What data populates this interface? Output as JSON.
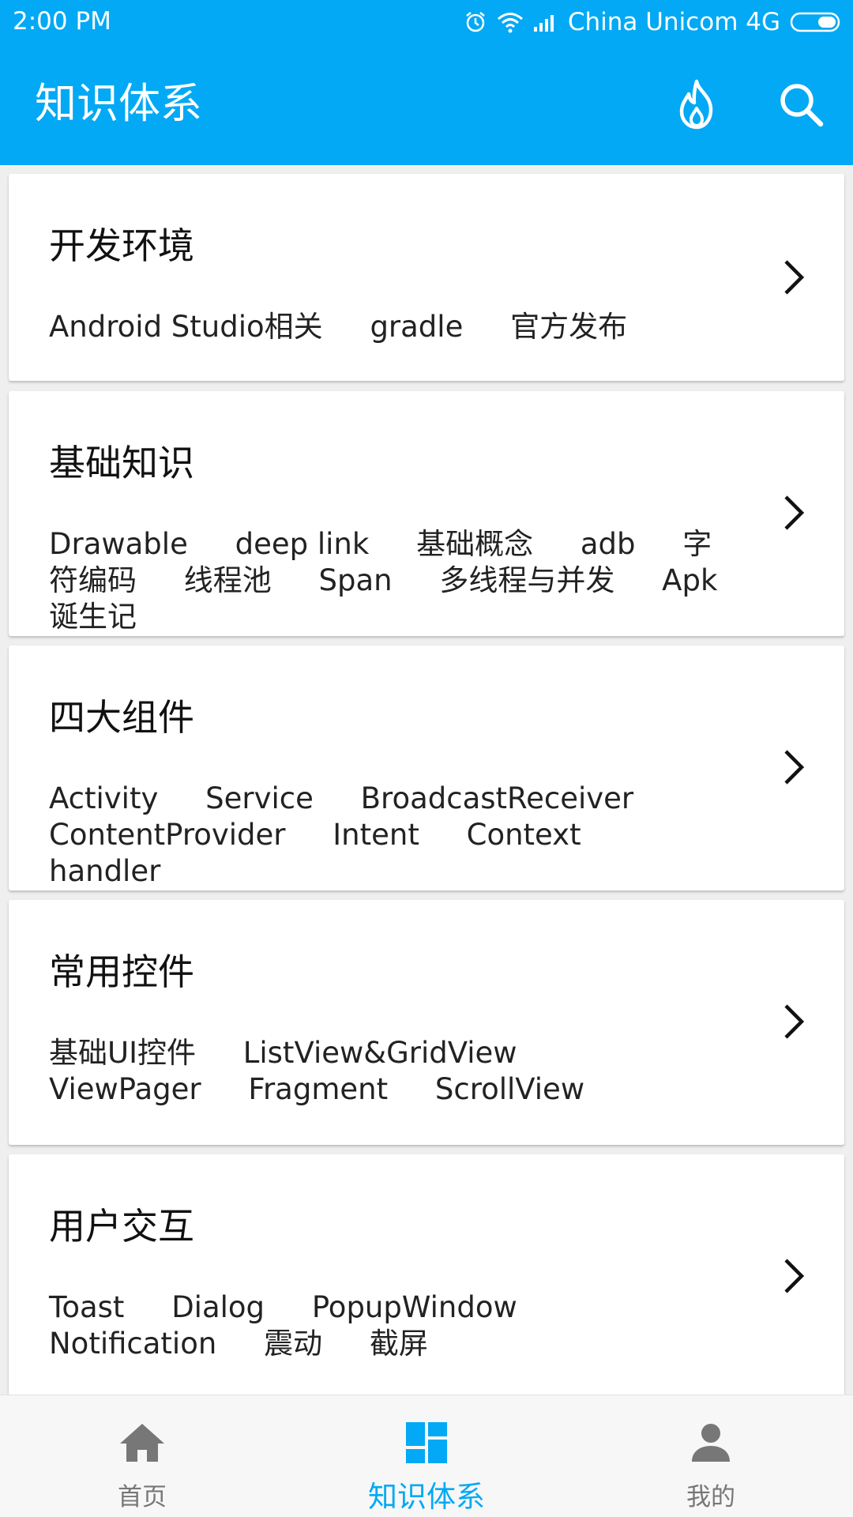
{
  "status_bar": {
    "time": "2:00 PM",
    "carrier": "China Unicom 4G",
    "icons": [
      "alarm-icon",
      "wifi-icon",
      "signal-icon",
      "battery-icon"
    ]
  },
  "app_bar": {
    "title": "知识体系",
    "actions": [
      "hot-icon",
      "search-icon"
    ]
  },
  "colors": {
    "accent": "#03a9f4",
    "nav_inactive": "#777777",
    "background": "#efefef"
  },
  "categories": [
    {
      "title": "开发环境",
      "tags": [
        "Android Studio相关",
        "gradle",
        "官方发布"
      ]
    },
    {
      "title": "基础知识",
      "tags": [
        "Drawable",
        "deep link",
        "基础概念",
        "adb",
        "字符编码",
        "线程池",
        "Span",
        "多线程与并发",
        "Apk诞生记"
      ]
    },
    {
      "title": "四大组件",
      "tags": [
        "Activity",
        "Service",
        "BroadcastReceiver",
        "ContentProvider",
        "Intent",
        "Context",
        "handler"
      ]
    },
    {
      "title": "常用控件",
      "tags": [
        "基础UI控件",
        "ListView&GridView",
        "ViewPager",
        "Fragment",
        "ScrollView"
      ]
    },
    {
      "title": "用户交互",
      "tags": [
        "Toast",
        "Dialog",
        "PopupWindow",
        "Notification",
        "震动",
        "截屏"
      ]
    }
  ],
  "bottom_nav": {
    "items": [
      {
        "label": "首页",
        "icon": "home-icon",
        "active": false
      },
      {
        "label": "知识体系",
        "icon": "dashboard-icon",
        "active": true
      },
      {
        "label": "我的",
        "icon": "person-icon",
        "active": false
      }
    ]
  }
}
